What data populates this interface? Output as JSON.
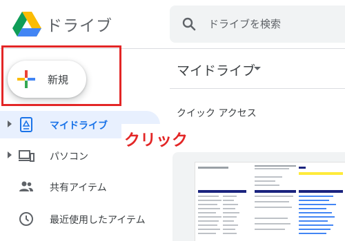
{
  "app": {
    "title": "ドライブ"
  },
  "search": {
    "placeholder": "ドライブを検索"
  },
  "new_button": {
    "label": "新規"
  },
  "annotation": {
    "text": "クリック",
    "color": "#e32626"
  },
  "sidebar": {
    "items": [
      {
        "label": "マイドライブ",
        "icon": "my-drive-icon",
        "active": true,
        "expandable": true
      },
      {
        "label": "パソコン",
        "icon": "computers-icon",
        "active": false,
        "expandable": true
      },
      {
        "label": "共有アイテム",
        "icon": "shared-people-icon",
        "active": false,
        "expandable": false
      },
      {
        "label": "最近使用したアイテム",
        "icon": "clock-icon",
        "active": false,
        "expandable": false
      }
    ]
  },
  "main": {
    "title": "マイドライブ",
    "quick_access": "クイック アクセス"
  },
  "colors": {
    "accent": "#1a73e8",
    "active_bg": "#e8f0fe",
    "highlight": "#e32626"
  }
}
